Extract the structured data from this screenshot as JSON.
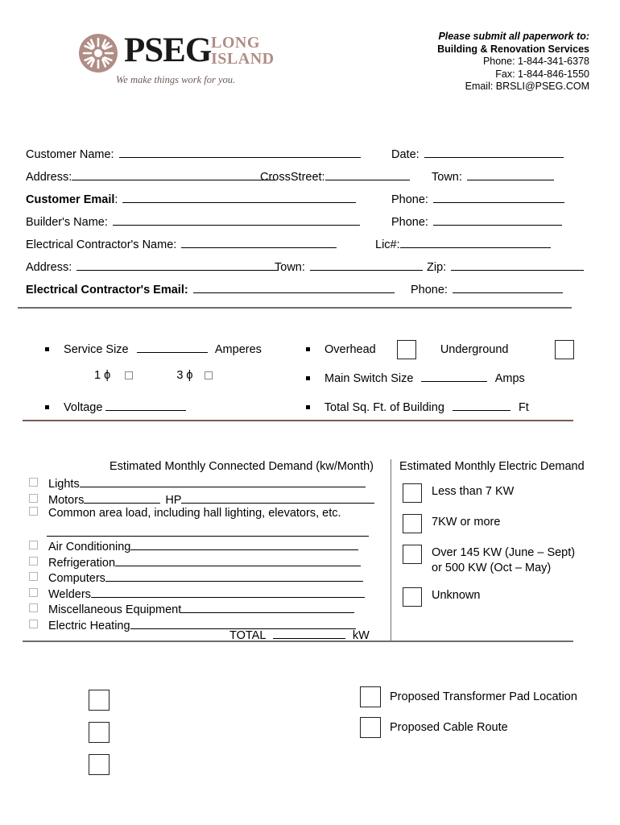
{
  "header": {
    "logo": {
      "mark_icon": "sunburst-icon",
      "brand": "PSEG",
      "region_line1": "LONG",
      "region_line2": "ISLAND",
      "tagline": "We make things work for you.",
      "brand_color": "#b08d85"
    },
    "submit_to": {
      "line1": "Please submit all paperwork to:",
      "line2": "Building & Renovation Services",
      "phone": "Phone: 1-844-341-6378",
      "fax": "Fax: 1-844-846-1550",
      "email": "Email: BRSLI@PSEG.COM"
    }
  },
  "info": {
    "customer_name_label": "Customer Name:",
    "date_label": "Date:",
    "address_label": "Address:",
    "cross_street_label": "CrossStreet:",
    "town_label": "Town:",
    "customer_email_label": "Customer Email",
    "customer_email_colon": ":",
    "phone_label": "Phone:",
    "builder_name_label": "Builder's Name:",
    "builder_phone_label": "Phone:",
    "contractor_name_label": "Electrical Contractor's Name:",
    "lic_label": "Lic#:",
    "contractor_address_label": "Address:",
    "contractor_town_label": "Town:",
    "zip_label": "Zip:",
    "contractor_email_label": "Electrical Contractor's Email:",
    "contractor_phone_label": "Phone:"
  },
  "service": {
    "service_size_label": "Service Size",
    "amperes_label": "Amperes",
    "phase_1_label": "1 ϕ",
    "phase_3_label": "3 ϕ",
    "voltage_label": "Voltage",
    "overhead_label": "Overhead",
    "underground_label": "Underground",
    "main_switch_label": "Main Switch Size",
    "amps_label": "Amps",
    "total_sqft_label": "Total Sq. Ft. of Building",
    "ft_label": "Ft"
  },
  "demand": {
    "connected_title": "Estimated Monthly Connected Demand (kw/Month)",
    "electric_title": "Estimated Monthly Electric Demand",
    "items": [
      {
        "label": "Lights",
        "line_width": 355
      },
      {
        "label": "Motors",
        "mid_label": "HP",
        "line_width": 95,
        "line2_width": 240
      },
      {
        "label": "Common area load, including hall lighting, elevators, etc.",
        "line_width": 0
      },
      {
        "label": "",
        "line_width": 400,
        "blank_row": true
      },
      {
        "label": "Air Conditioning",
        "line_width": 283
      },
      {
        "label": "Refrigeration",
        "line_width": 305
      },
      {
        "label": "Computers",
        "line_width": 320
      },
      {
        "label": "Welders",
        "line_width": 340
      },
      {
        "label": "Miscellaneous Equipment",
        "line_width": 215
      },
      {
        "label": "Electric Heating",
        "line_width": 280
      }
    ],
    "total_label": "TOTAL",
    "total_unit": "kW",
    "electric_options": [
      "Less than 7 KW",
      "7KW or more",
      "Over 145 KW (June – Sept)\nor 500 KW (Oct – May)",
      "Unknown"
    ]
  },
  "bottom": {
    "unlabeled_checkbox_count": 3,
    "options": [
      "Proposed Transformer Pad Location",
      "Proposed Cable Route"
    ]
  },
  "colors": {
    "rule_gray": "#6d6d6d",
    "rule_brown": "#7a5c54",
    "brand": "#b08d85"
  }
}
